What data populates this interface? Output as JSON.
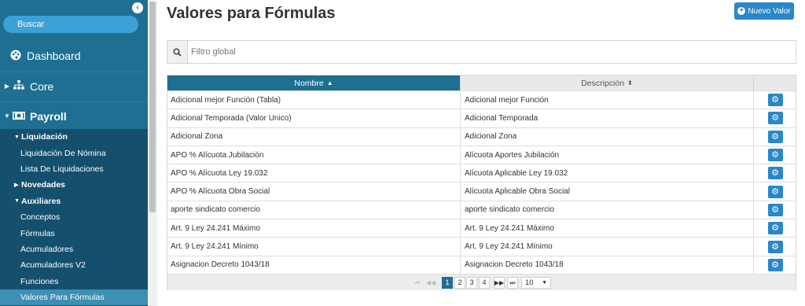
{
  "sidebar": {
    "search_label": "Buscar",
    "items": [
      {
        "label": "Dashboard",
        "icon": "palette-icon"
      },
      {
        "label": "Core",
        "icon": "sitemap-icon"
      },
      {
        "label": "Payroll",
        "icon": "money-icon"
      }
    ],
    "subitems": [
      {
        "label": "Liquidación",
        "type": "group",
        "expanded": true
      },
      {
        "label": "Liquidación De Nómina",
        "type": "item"
      },
      {
        "label": "Lista De Liquidaciones",
        "type": "item"
      },
      {
        "label": "Novedades",
        "type": "group",
        "expanded": false
      },
      {
        "label": "Auxiliares",
        "type": "group",
        "expanded": true
      },
      {
        "label": "Conceptos",
        "type": "item"
      },
      {
        "label": "Fórmulas",
        "type": "item"
      },
      {
        "label": "Acumuladores",
        "type": "item"
      },
      {
        "label": "Acumuladores V2",
        "type": "item"
      },
      {
        "label": "Funciones",
        "type": "item"
      },
      {
        "label": "Valores Para Fórmulas",
        "type": "item",
        "active": true
      }
    ]
  },
  "page": {
    "title": "Valores para Fórmulas",
    "new_button_label": "Nuevo Valor"
  },
  "filter": {
    "placeholder": "Filtro global"
  },
  "table": {
    "columns": [
      {
        "label": "Nombre",
        "sorted": "asc"
      },
      {
        "label": "Descripción",
        "sorted": "none"
      },
      {
        "label": ""
      }
    ],
    "rows": [
      {
        "name": "Adicional mejor Función (Tabla)",
        "description": "Adicional mejor Función"
      },
      {
        "name": "Adicional Temporada (Valor Unico)",
        "description": "Adicional Temporada"
      },
      {
        "name": "Adicional Zona",
        "description": "Adicional Zona"
      },
      {
        "name": "APO % Alícuota Jubilación",
        "description": "Alícuota Aportes Jubilación"
      },
      {
        "name": "APO % Alícuota Ley 19.032",
        "description": "Alícuota Aplicable Ley 19.032"
      },
      {
        "name": "APO % Alícuota Obra Social",
        "description": "Alícuota Aplicable Obra Social"
      },
      {
        "name": "aporte sindicato comercio",
        "description": "aporte sindicato comercio"
      },
      {
        "name": "Art. 9 Ley 24.241 Máximo",
        "description": "Art. 9 Ley 24.241 Máximo"
      },
      {
        "name": "Art. 9 Ley 24.241 Mínimo",
        "description": "Art. 9 Ley 24.241 Mínimo"
      },
      {
        "name": "Asignacion Decreto 1043/18",
        "description": "Asignacion Decreto 1043/18"
      }
    ]
  },
  "pagination": {
    "pages": [
      "1",
      "2",
      "3",
      "4"
    ],
    "current_page": "1",
    "page_size": "10"
  },
  "colors": {
    "sidebar": "#1f6f92",
    "sidebar_sub": "#14506d",
    "accent": "#2a87c8",
    "search": "#3aa2d6"
  }
}
